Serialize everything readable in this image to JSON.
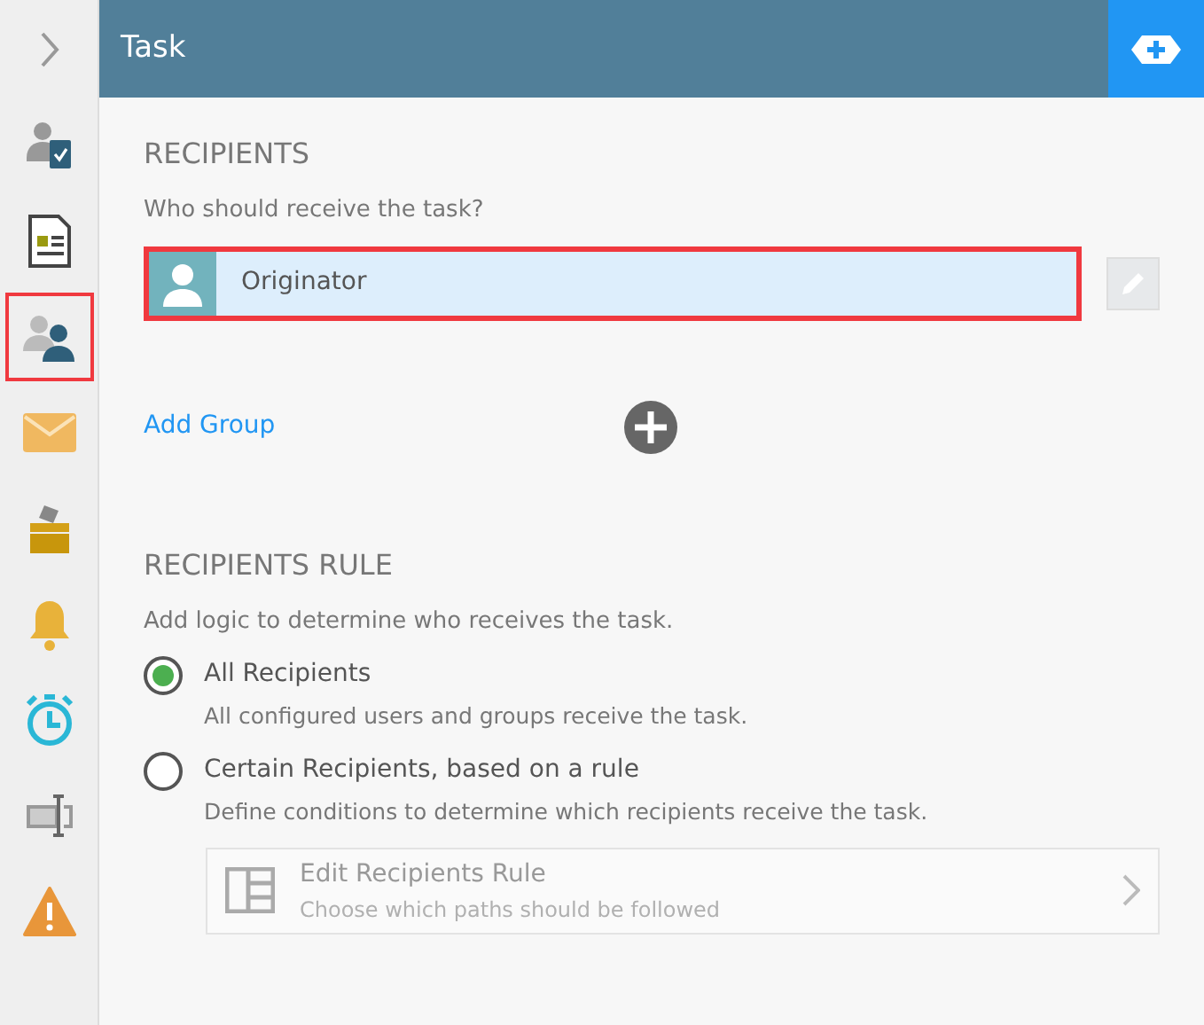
{
  "sidebar": {
    "items": [
      {
        "kind": "user-check",
        "highlighted": false
      },
      {
        "kind": "form",
        "highlighted": false
      },
      {
        "kind": "users",
        "highlighted": true
      },
      {
        "kind": "mail",
        "highlighted": false
      },
      {
        "kind": "inbox",
        "highlighted": false
      },
      {
        "kind": "bell",
        "highlighted": false
      },
      {
        "kind": "timer",
        "highlighted": false
      },
      {
        "kind": "textbox",
        "highlighted": false
      },
      {
        "kind": "warning",
        "highlighted": false
      }
    ]
  },
  "header": {
    "title": "Task"
  },
  "recipients": {
    "heading": "RECIPIENTS",
    "prompt": "Who should receive the task?",
    "items": [
      {
        "name": "Originator",
        "highlighted": true
      }
    ],
    "add_group": "Add Group"
  },
  "rule": {
    "heading": "RECIPIENTS RULE",
    "prompt": "Add logic to determine who receives the task.",
    "options": [
      {
        "label": "All Recipients",
        "description": "All configured users and groups receive the task.",
        "selected": true
      },
      {
        "label": "Certain Recipients, based on a rule",
        "description": "Define conditions to determine which recipients receive the task.",
        "selected": false
      }
    ],
    "edit": {
      "title": "Edit Recipients Rule",
      "subtitle": "Choose which paths should be followed",
      "disabled": true
    }
  }
}
